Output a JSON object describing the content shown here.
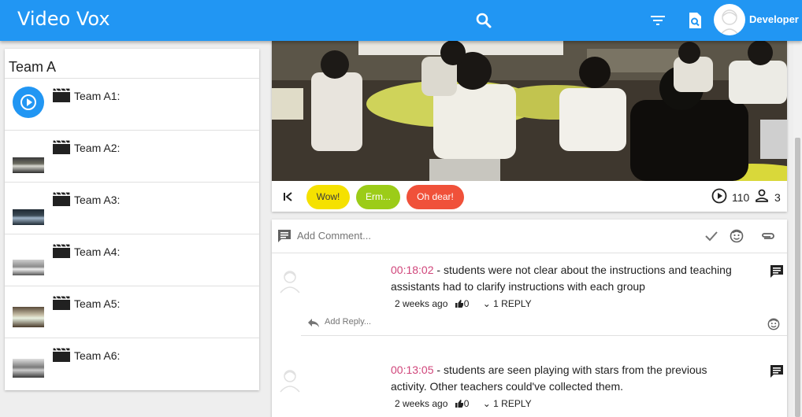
{
  "header": {
    "title": "Video Vox",
    "user_label": "Developer",
    "icons": [
      "search-icon",
      "filter-icon",
      "find-in-page-icon",
      "user-avatar"
    ]
  },
  "colors": {
    "primary": "#2196f3",
    "timecode": "#d0457a",
    "wow_chip": "#f5e100",
    "erm_chip": "#9ccc18",
    "oh_dear_chip": "#f0513a"
  },
  "sidebar": {
    "title": "Team A",
    "items": [
      {
        "label": "Team A1:",
        "icon": "play-circle-icon",
        "active": true
      },
      {
        "label": "Team A2:",
        "icon": "video-thumbnail"
      },
      {
        "label": "Team A3:",
        "icon": "video-thumbnail"
      },
      {
        "label": "Team A4:",
        "icon": "video-thumbnail"
      },
      {
        "label": "Team A5:",
        "icon": "video-thumbnail"
      },
      {
        "label": "Team A6:",
        "icon": "video-thumbnail"
      }
    ]
  },
  "player": {
    "reactions": {
      "wow": "Wow!",
      "erm": "Erm...",
      "oh_dear": "Oh dear!"
    },
    "views_count": "110",
    "viewers_count": "3"
  },
  "comments": {
    "add_placeholder": "Add Comment...",
    "reply_placeholder": "Add Reply...",
    "items": [
      {
        "timecode": "00:18:02",
        "text": " - students were not clear about the instructions and teaching assistants had to clarify instructions with each group",
        "age": "2 weeks ago",
        "likes": "0",
        "replies": "1 REPLY"
      },
      {
        "timecode": "00:13:05",
        "text": " - students are seen playing with stars from the previous activity. Other teachers could've collected them.",
        "age": "2 weeks ago",
        "likes": "0",
        "replies": "1 REPLY"
      }
    ]
  }
}
